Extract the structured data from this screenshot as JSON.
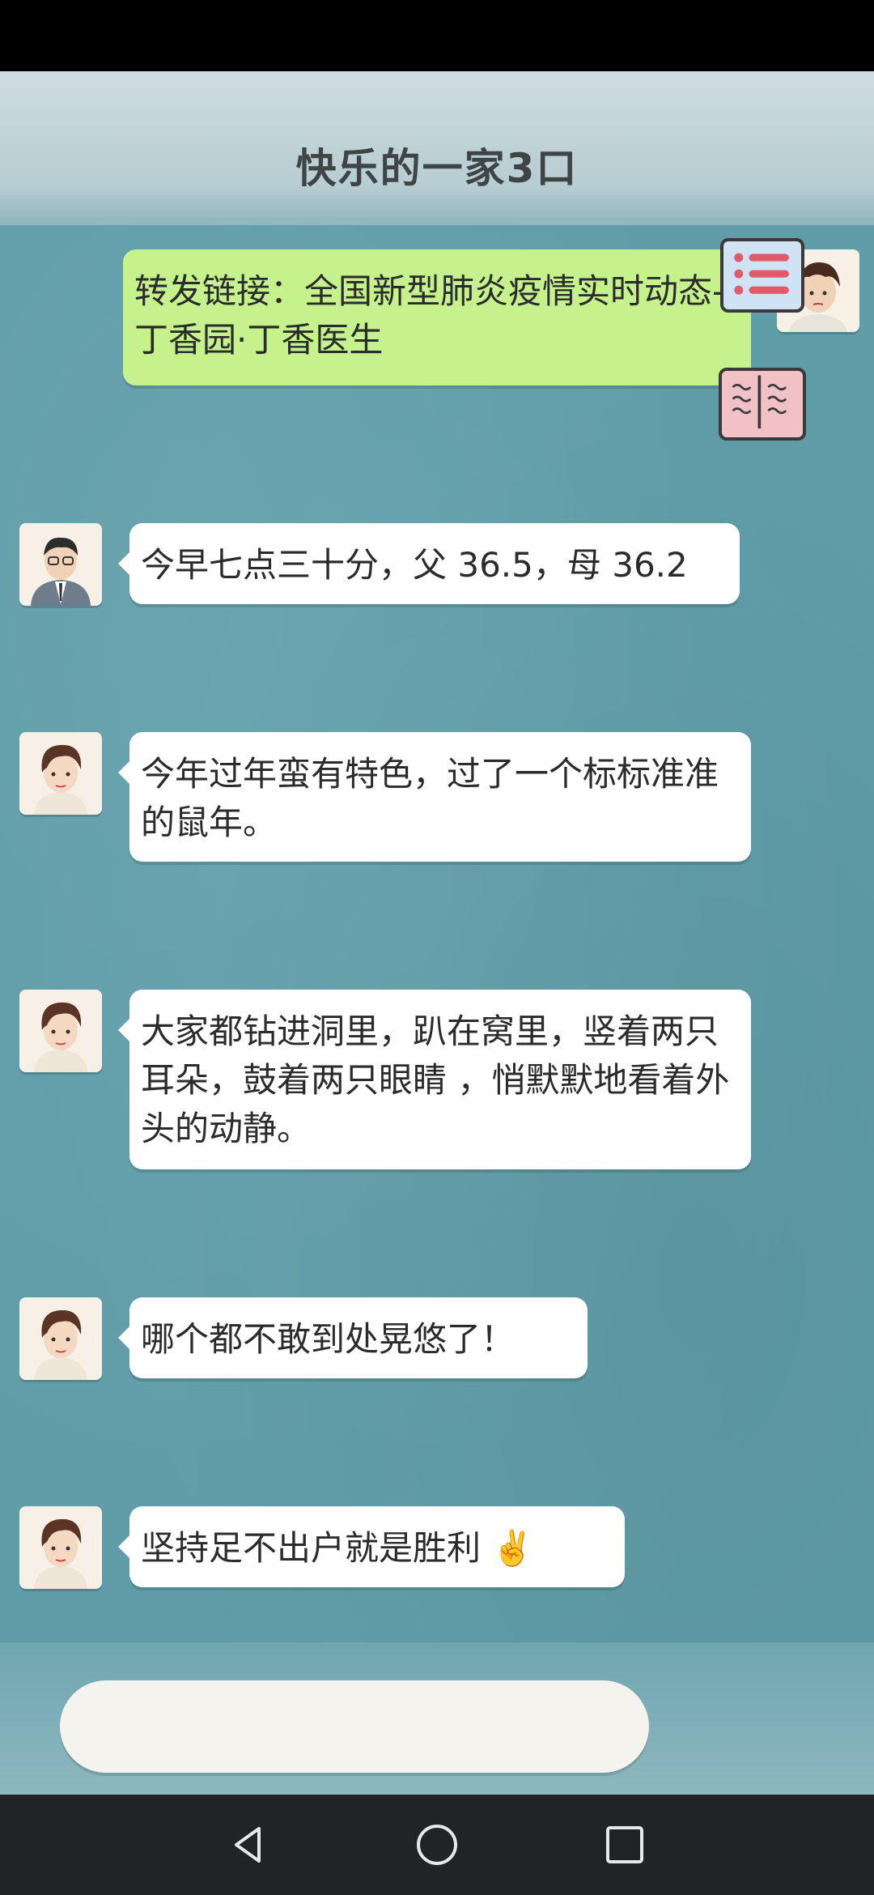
{
  "chat": {
    "title": "快乐的一家3口"
  },
  "messages": [
    {
      "sender": "son",
      "side": "right",
      "text": "转发链接：全国新型肺炎疫情实时动态-丁香园·丁香医生"
    },
    {
      "sender": "father",
      "side": "left",
      "text": "今早七点三十分，父 36.5，母 36.2"
    },
    {
      "sender": "mother",
      "side": "left",
      "text": "今年过年蛮有特色，过了一个标标准准的鼠年。"
    },
    {
      "sender": "mother",
      "side": "left",
      "text": "大家都钻进洞里，趴在窝里，竖着两只耳朵，鼓着两只眼睛 ，悄默默地看着外头的动静。"
    },
    {
      "sender": "mother",
      "side": "left",
      "text": "哪个都不敢到处晃悠了！"
    },
    {
      "sender": "mother",
      "side": "left",
      "text": "坚持足不出户就是胜利 ✌️"
    }
  ],
  "overlay_icons": [
    "list-icon",
    "book-icon"
  ],
  "nav": {
    "back_icon": "triangle-back-icon",
    "home_icon": "circle-home-icon",
    "recents_icon": "square-recents-icon"
  },
  "colors": {
    "background": "#5f9da9",
    "bubble_sent": "#c6f28e",
    "bubble_received": "#ffffff",
    "nav_bar": "#222326"
  }
}
